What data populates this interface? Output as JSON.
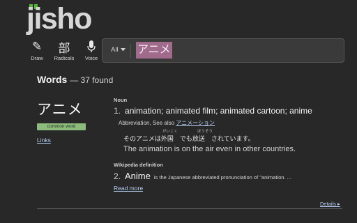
{
  "logo": {
    "text": "jisho"
  },
  "tools": [
    {
      "glyph": "✎",
      "icon": "draw-icon",
      "label": "Draw"
    },
    {
      "glyph": "部",
      "icon": "radicals-icon",
      "label": "Radicals"
    },
    {
      "glyph": "🎙",
      "icon": "microphone-icon",
      "label": "Voice"
    }
  ],
  "search": {
    "scope": "All",
    "value": "アニメ"
  },
  "results": {
    "heading": "Words",
    "count_text": "— 37 found"
  },
  "entry": {
    "word": "アニメ",
    "badge": "common word",
    "links_label": "Links",
    "meanings": [
      {
        "pos": "Noun",
        "number": "1.",
        "text": "animation; animated film; animated cartoon; anime",
        "supplemental": "Abbreviation, See also",
        "see_also": "アニメーション",
        "sentence_jp": "そのアニメは外国　でも放送　されています。",
        "furigana": [
          "がいこく",
          "ほうそう"
        ],
        "sentence_en": "The animation is on the air even in other countries."
      },
      {
        "pos": "Wikipedia definition",
        "number": "2.",
        "text": "Anime",
        "desc": "is the Japanese abbreviated pronunciation of \"animation. ..."
      }
    ],
    "read_more": "Read more",
    "details": "Details ▸"
  },
  "colors": {
    "background": "#282828",
    "logo_accent": "#56b140",
    "search_highlight": "#a16b8b",
    "badge": "#8dbb7c",
    "link": "#b6cff2"
  }
}
